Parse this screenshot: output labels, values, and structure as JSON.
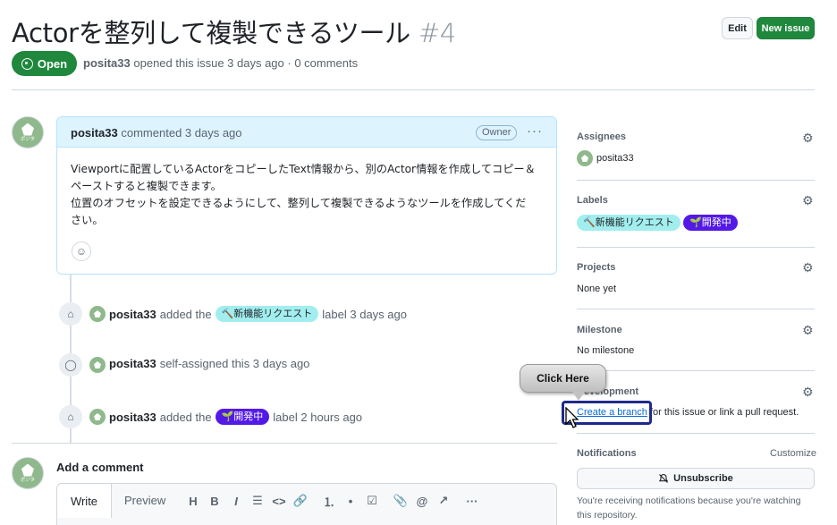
{
  "issue": {
    "title": "Actorを整列して複製できるツール",
    "number": "#4",
    "state": "Open",
    "author": "posita33",
    "meta_rest": "opened this issue 3 days ago · 0 comments"
  },
  "header_buttons": {
    "edit": "Edit",
    "new_issue": "New issue"
  },
  "comment": {
    "author": "posita33",
    "action": "commented 3 days ago",
    "badge": "Owner",
    "body_line1": "Viewportに配置しているActorをコピーしたText情報から、別のActor情報を作成してコピー＆",
    "body_line2": "ペーストすると複製できます。",
    "body_line3": "位置のオフセットを設定できるようにして、整列して複製できるようなツールを作成してくだ",
    "body_line4": "さい。"
  },
  "timeline": [
    {
      "user": "posita33",
      "pre": "added the",
      "label": "🔨新機能リクエスト",
      "post": "label 3 days ago"
    },
    {
      "user": "posita33",
      "pre": "self-assigned this 3 days ago"
    },
    {
      "user": "posita33",
      "pre": "added the",
      "label": "🌱開発中",
      "post": "label 2 hours ago"
    }
  ],
  "add_comment": {
    "title": "Add a comment",
    "tab_write": "Write",
    "tab_preview": "Preview",
    "tools": [
      "H",
      "B",
      "I",
      "☰",
      "<>",
      "🔗",
      "⒈",
      "•",
      "☑",
      "📎",
      "@",
      "↗",
      "···"
    ]
  },
  "sidebar": {
    "assignees_h": "Assignees",
    "assignee": "posita33",
    "labels_h": "Labels",
    "label1": "🔨新機能リクエスト",
    "label2": "🌱開発中",
    "projects_h": "Projects",
    "projects_v": "None yet",
    "milestone_h": "Milestone",
    "milestone_v": "No milestone",
    "development_h": "Development",
    "development_link": "Create a branch",
    "development_rest": " for this issue or link a pull request.",
    "notifications_h": "Notifications",
    "customize": "Customize",
    "unsubscribe": "Unsubscribe",
    "notif_text": "You're receiving notifications because you're watching this repository."
  },
  "callout": {
    "text": "Click Here"
  },
  "colors": {
    "open_green": "#1f883d",
    "label_request": "#a2eeef",
    "label_dev": "#5319e7",
    "highlight": "#1e2a8a"
  }
}
